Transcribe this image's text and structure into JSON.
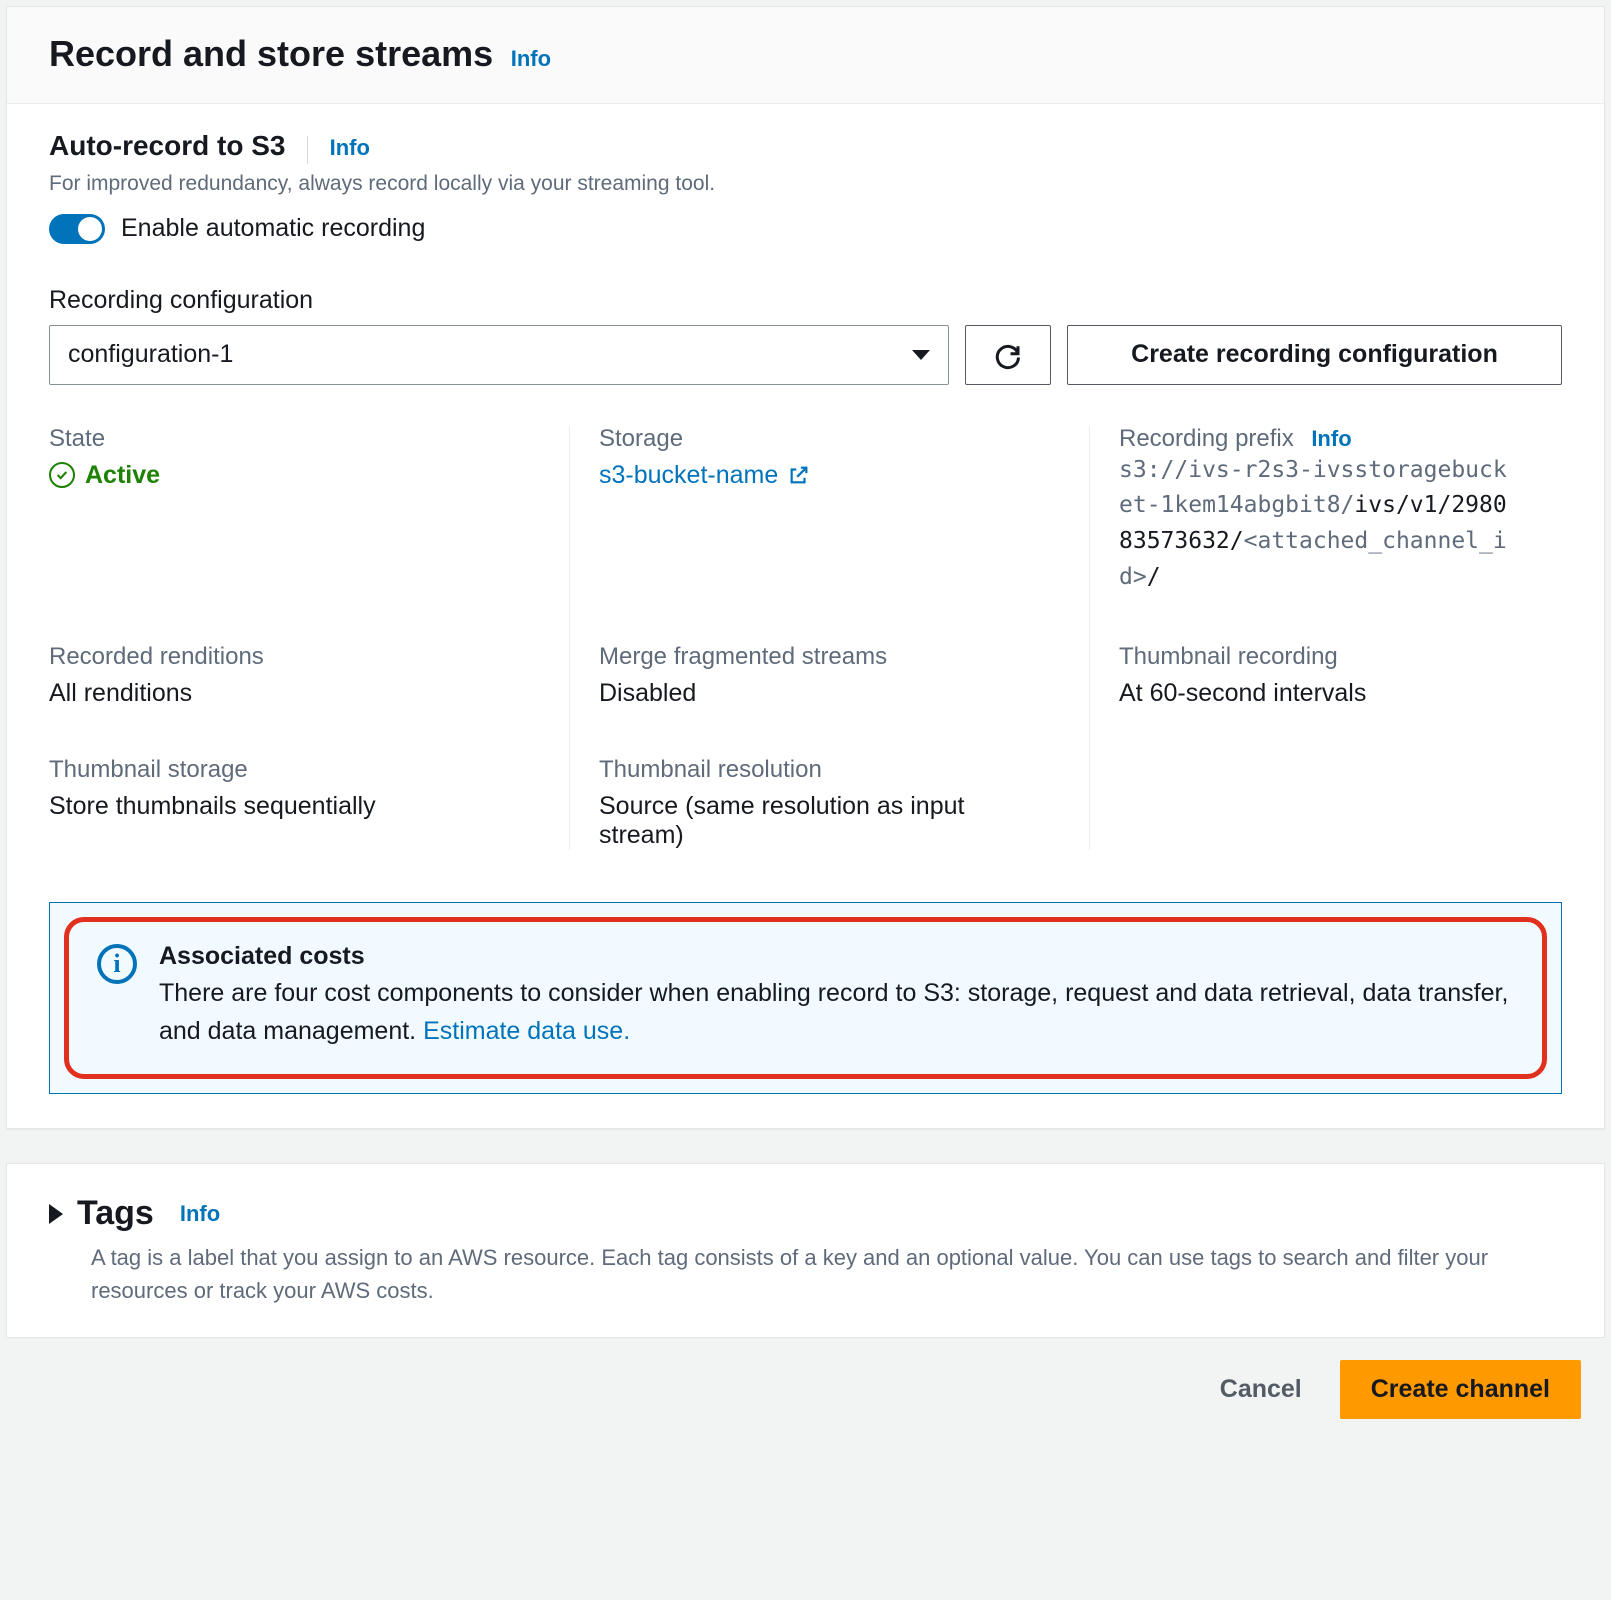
{
  "panel": {
    "title": "Record and store streams",
    "info": "Info"
  },
  "autoRecord": {
    "title": "Auto-record to S3",
    "info": "Info",
    "desc": "For improved redundancy, always record locally via your streaming tool.",
    "toggleLabel": "Enable automatic recording"
  },
  "recordingConfig": {
    "label": "Recording configuration",
    "selected": "configuration-1",
    "createBtn": "Create recording configuration"
  },
  "details": {
    "state": {
      "label": "State",
      "value": "Active"
    },
    "storage": {
      "label": "Storage",
      "value": "s3-bucket-name"
    },
    "prefix": {
      "label": "Recording prefix",
      "info": "Info",
      "gray1": "s3://ivs-r2s3-ivsstoragebucket-1kem14abgbit8/",
      "dark1": "ivs/v1/298083573632/",
      "gray2": "<attached_channel_id>",
      "dark2": "/"
    },
    "renditions": {
      "label": "Recorded renditions",
      "value": "All renditions"
    },
    "merge": {
      "label": "Merge fragmented streams",
      "value": "Disabled"
    },
    "thumbRec": {
      "label": "Thumbnail recording",
      "value": "At 60-second intervals"
    },
    "thumbStore": {
      "label": "Thumbnail storage",
      "value": "Store thumbnails sequentially"
    },
    "thumbRes": {
      "label": "Thumbnail resolution",
      "value": "Source (same resolution as input stream)"
    }
  },
  "callout": {
    "title": "Associated costs",
    "text": "There are four cost components to consider when enabling record to S3: storage, request and data retrieval, data transfer, and data management. ",
    "link": "Estimate data use."
  },
  "tags": {
    "title": "Tags",
    "info": "Info",
    "desc": "A tag is a label that you assign to an AWS resource. Each tag consists of a key and an optional value. You can use tags to search and filter your resources or track your AWS costs."
  },
  "footer": {
    "cancel": "Cancel",
    "create": "Create channel"
  }
}
